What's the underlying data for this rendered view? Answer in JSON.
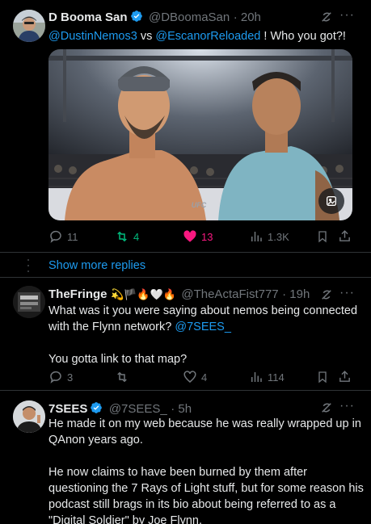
{
  "tweet1": {
    "name": "D Booma San",
    "handle": "@DBoomaSan",
    "time": "· 20h",
    "mention1": "@DustinNemos3",
    "vs": " vs ",
    "mention2": "@EscanorReloaded",
    "rest": " ! Who you got?!",
    "image_badge": "UFC",
    "replies": "11",
    "reposts": "4",
    "likes": "13",
    "views": "1.3K"
  },
  "show_more": "Show more replies",
  "tweet2": {
    "name": "TheFringe",
    "emojis": "💫🏴🔥🤍🔥",
    "handle": "@TheActaFist777",
    "time": "· 19h",
    "line1": "What was it you were saying about nemos being connected",
    "line2a": "with the Flynn network? ",
    "line2b": "@7SEES_",
    "line3": "You gotta link to that map?",
    "replies": "3",
    "reposts": "",
    "likes": "4",
    "views": "114"
  },
  "tweet3": {
    "name": "7SEES",
    "handle": "@7SEES_",
    "time": "· 5h",
    "p1l1": "He made it on my web because he was really wrapped up in",
    "p1l2": "QAnon years ago.",
    "p2l1": "He now claims to have been burned by them after",
    "p2l2": "questioning the 7 Rays of Light stuff, but for some reason his",
    "p2l3": "podcast still brags in its bio about being referred to as a",
    "p2l4": "\"Digital Soldier\" by Joe Flynn."
  },
  "colors": {
    "accent": "#1d9bf0",
    "like": "#f91880",
    "repost": "#00ba7c",
    "muted": "#71767b"
  }
}
